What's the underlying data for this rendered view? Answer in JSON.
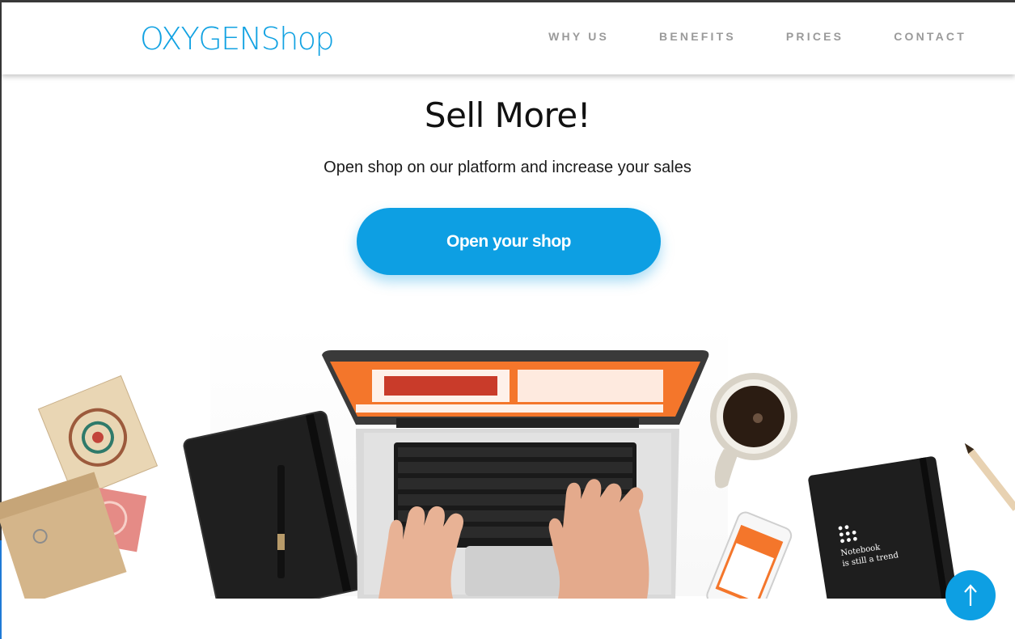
{
  "header": {
    "logo": "OXYGENShop",
    "nav": [
      {
        "label": "WHY US"
      },
      {
        "label": "BENEFITS"
      },
      {
        "label": "PRICES"
      },
      {
        "label": "CONTACT"
      }
    ]
  },
  "hero": {
    "title": "Sell More!",
    "subtitle": "Open shop on our platform and increase your sales",
    "cta_label": "Open your shop"
  },
  "illustration": {
    "notebook_text_line1": "Notebook",
    "notebook_text_line2": "is still a trend"
  },
  "scroll_top": {
    "icon": "arrow-up-icon"
  },
  "colors": {
    "brand": "#12a2e2",
    "button": "#0d9fe3",
    "nav_text": "#9a9a9a",
    "screen_orange": "#f4762b"
  }
}
